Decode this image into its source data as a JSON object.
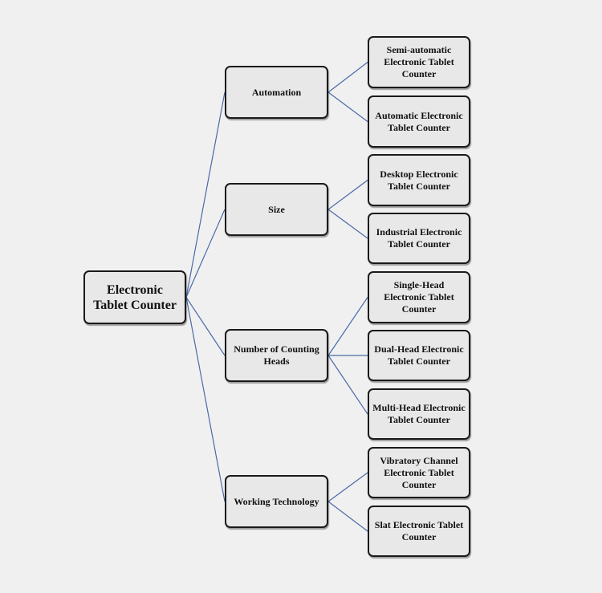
{
  "diagram": {
    "root": {
      "label": "Electronic Tablet Counter"
    },
    "line_color": "#4a6aa8",
    "categories": [
      {
        "label": "Automation",
        "children": [
          {
            "label": "Semi-automatic Electronic Tablet Counter"
          },
          {
            "label": "Automatic Electronic Tablet Counter"
          }
        ]
      },
      {
        "label": "Size",
        "children": [
          {
            "label": "Desktop Electronic Tablet Counter"
          },
          {
            "label": "Industrial Electronic Tablet Counter"
          }
        ]
      },
      {
        "label": "Number of Counting Heads",
        "children": [
          {
            "label": "Single-Head Electronic Tablet Counter"
          },
          {
            "label": "Dual-Head Electronic Tablet Counter"
          },
          {
            "label": "Multi-Head Electronic Tablet Counter"
          }
        ]
      },
      {
        "label": "Working Technology",
        "children": [
          {
            "label": "Vibratory Channel Electronic Tablet Counter"
          },
          {
            "label": "Slat Electronic Tablet Counter"
          }
        ]
      }
    ]
  }
}
